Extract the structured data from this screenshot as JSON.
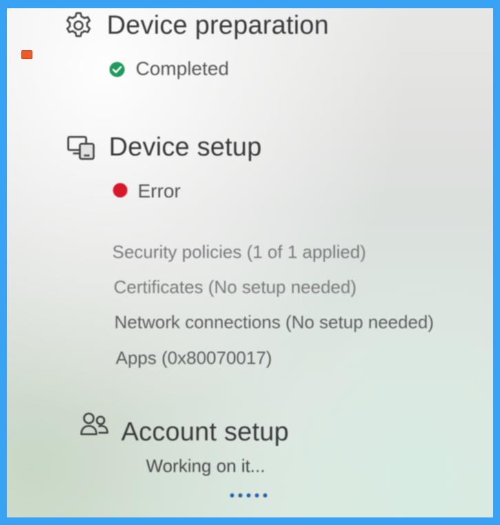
{
  "colors": {
    "frame_blue": "#3aa2f3",
    "completed_green": "#1f9a5a",
    "error_red": "#d7182b",
    "progress_blue": "#2a5fb0"
  },
  "logo": {
    "icon": "site-logo-badge"
  },
  "sections": {
    "device_preparation": {
      "icon": "gear-icon",
      "title": "Device preparation",
      "status": "Completed",
      "status_icon": "check-circle-icon"
    },
    "device_setup": {
      "icon": "devices-icon",
      "title": "Device setup",
      "status": "Error",
      "status_icon": "error-dot-icon",
      "details": [
        "Security policies (1 of 1 applied)",
        "Certificates (No setup needed)",
        "Network connections (No setup needed)",
        "Apps (0x80070017)"
      ]
    },
    "account_setup": {
      "icon": "people-icon",
      "title": "Account setup",
      "status": "Working on it...",
      "progress_icon": "progress-dots-icon"
    }
  }
}
